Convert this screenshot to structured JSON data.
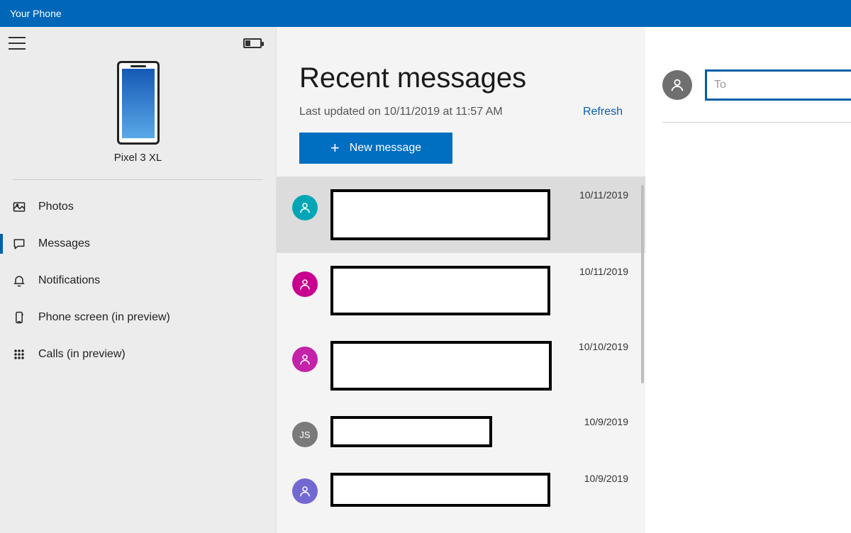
{
  "titlebar": {
    "title": "Your Phone"
  },
  "left": {
    "phone_name": "Pixel 3 XL",
    "nav": [
      {
        "key": "photos",
        "label": "Photos",
        "icon": "photos-icon",
        "selected": false
      },
      {
        "key": "messages",
        "label": "Messages",
        "icon": "messages-icon",
        "selected": true
      },
      {
        "key": "notifications",
        "label": "Notifications",
        "icon": "notifications-icon",
        "selected": false
      },
      {
        "key": "phonescreen",
        "label": "Phone screen (in preview)",
        "icon": "phonescreen-icon",
        "selected": false
      },
      {
        "key": "calls",
        "label": "Calls (in preview)",
        "icon": "calls-icon",
        "selected": false
      }
    ]
  },
  "middle": {
    "title": "Recent messages",
    "subtitle": "Last updated on 10/11/2019 at 11:57 AM",
    "refresh_label": "Refresh",
    "new_message_label": "New message",
    "threads": [
      {
        "avatar_color": "av-teal",
        "avatar_text": "",
        "date": "10/11/2019",
        "selected": true,
        "redact_w": 310,
        "redact_h": 72
      },
      {
        "avatar_color": "av-pink",
        "avatar_text": "",
        "date": "10/11/2019",
        "selected": false,
        "redact_w": 310,
        "redact_h": 70
      },
      {
        "avatar_color": "av-magenta",
        "avatar_text": "",
        "date": "10/10/2019",
        "selected": false,
        "redact_w": 312,
        "redact_h": 70
      },
      {
        "avatar_color": "av-gray",
        "avatar_text": "JS",
        "date": "10/9/2019",
        "selected": false,
        "redact_w": 228,
        "redact_h": 44
      },
      {
        "avatar_color": "av-violet",
        "avatar_text": "",
        "date": "10/9/2019",
        "selected": false,
        "redact_w": 310,
        "redact_h": 48
      }
    ]
  },
  "right": {
    "to_placeholder": "To"
  }
}
